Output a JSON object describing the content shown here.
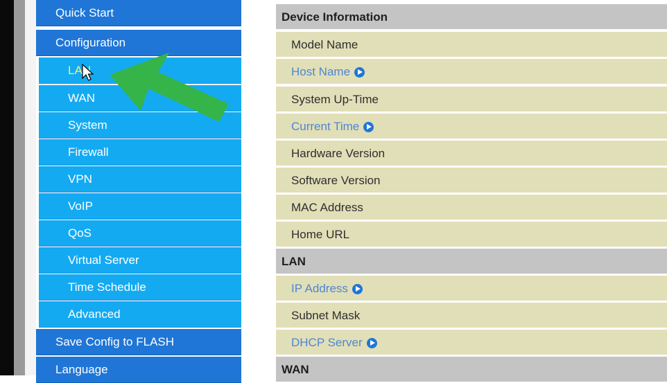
{
  "sidebar": {
    "items": [
      {
        "label": "Quick Start"
      },
      {
        "label": "Configuration"
      },
      {
        "label": "LAN"
      },
      {
        "label": "WAN"
      },
      {
        "label": "System"
      },
      {
        "label": "Firewall"
      },
      {
        "label": "VPN"
      },
      {
        "label": "VoIP"
      },
      {
        "label": "QoS"
      },
      {
        "label": "Virtual Server"
      },
      {
        "label": "Time Schedule"
      },
      {
        "label": "Advanced"
      },
      {
        "label": "Save Config to FLASH"
      },
      {
        "label": "Language"
      }
    ],
    "active_item": "LAN"
  },
  "content": {
    "sections": [
      {
        "title": "Device Information",
        "fields": [
          "Model Name",
          "Host Name",
          "System Up-Time",
          "Current Time",
          "Hardware Version",
          "Software Version",
          "MAC Address",
          "Home URL"
        ]
      },
      {
        "title": "LAN",
        "fields": [
          "IP Address",
          "Subnet Mask",
          "DHCP Server"
        ]
      },
      {
        "title": "WAN",
        "fields": []
      }
    ]
  },
  "icons": {
    "link_arrow": "circle-arrow-right-icon",
    "pointer": "mouse-cursor-icon",
    "annotation": "green-arrow-icon"
  },
  "colors": {
    "nav_top": "#1f76d6",
    "nav_sub": "#14aaf2",
    "header_row": "#c4c4c4",
    "field_row": "#e1dfb8",
    "link_text": "#4f86d0",
    "annotation_arrow": "#35b44a"
  }
}
